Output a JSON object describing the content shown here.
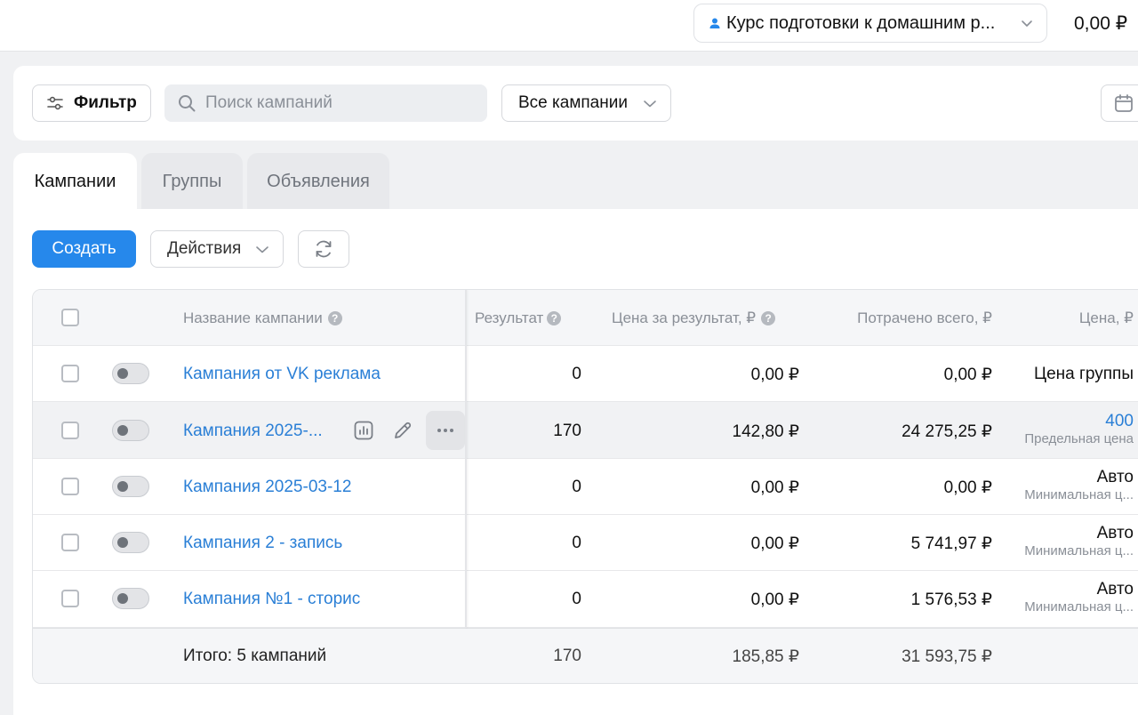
{
  "topbar": {
    "account_label": "Курс подготовки к домашним р...",
    "balance": "0,00 ₽"
  },
  "filterbar": {
    "filter_label": "Фильтр",
    "search_placeholder": "Поиск кампаний",
    "campaign_select": "Все кампании"
  },
  "tabs": [
    {
      "label": "Кампании",
      "active": true
    },
    {
      "label": "Группы",
      "active": false
    },
    {
      "label": "Объявления",
      "active": false
    }
  ],
  "toolbar": {
    "create_label": "Создать",
    "actions_label": "Действия"
  },
  "table": {
    "headers": {
      "name": "Название кампании",
      "result": "Результат",
      "price_per_result": "Цена за результат, ₽",
      "spent": "Потрачено всего, ₽",
      "bid": "Цена, ₽"
    },
    "rows": [
      {
        "name": "Кампания от VK реклама",
        "result": "0",
        "price": "0,00 ₽",
        "spent": "0,00 ₽",
        "bid_main": "Цена группы",
        "bid_sub": ""
      },
      {
        "name": "Кампания 2025-...",
        "result": "170",
        "price": "142,80 ₽",
        "spent": "24 275,25 ₽",
        "bid_main": "400",
        "bid_sub": "Предельная цена"
      },
      {
        "name": "Кампания 2025-03-12",
        "result": "0",
        "price": "0,00 ₽",
        "spent": "0,00 ₽",
        "bid_main": "Авто",
        "bid_sub": "Минимальная ц..."
      },
      {
        "name": "Кампания 2 - запись",
        "result": "0",
        "price": "0,00 ₽",
        "spent": "5 741,97 ₽",
        "bid_main": "Авто",
        "bid_sub": "Минимальная ц..."
      },
      {
        "name": "Кампания №1 - сторис",
        "result": "0",
        "price": "0,00 ₽",
        "spent": "1 576,53 ₽",
        "bid_main": "Авто",
        "bid_sub": "Минимальная ц..."
      }
    ],
    "total": {
      "label": "Итого: 5 кампаний",
      "result": "170",
      "price": "185,85 ₽",
      "spent": "31 593,75 ₽"
    }
  },
  "icons": {
    "account": "person-icon",
    "filter": "sliders-icon",
    "search": "magnifier-icon",
    "calendar": "calendar-icon",
    "refresh": "refresh-icon",
    "stats": "bar-chart-icon",
    "edit": "pencil-icon",
    "more": "more-horizontal-icon"
  },
  "colors": {
    "accent": "#2688eb",
    "link": "#2a7fd6",
    "muted": "#8a8f97"
  }
}
